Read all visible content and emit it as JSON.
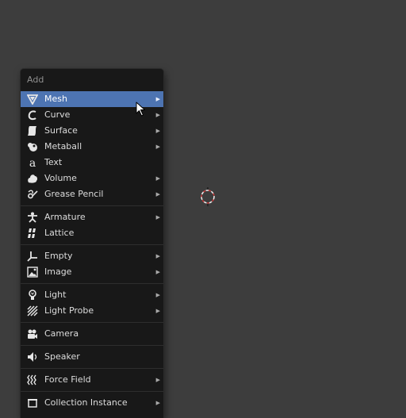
{
  "menu": {
    "title": "Add",
    "groups": [
      [
        {
          "label": "Mesh",
          "icon": "mesh-icon",
          "submenu": true,
          "active": true
        },
        {
          "label": "Curve",
          "icon": "curve-icon",
          "submenu": true
        },
        {
          "label": "Surface",
          "icon": "surface-icon",
          "submenu": true
        },
        {
          "label": "Metaball",
          "icon": "metaball-icon",
          "submenu": true
        },
        {
          "label": "Text",
          "icon": "text-icon",
          "submenu": false
        },
        {
          "label": "Volume",
          "icon": "volume-icon",
          "submenu": true
        },
        {
          "label": "Grease Pencil",
          "icon": "grease-pencil-icon",
          "submenu": true
        }
      ],
      [
        {
          "label": "Armature",
          "icon": "armature-icon",
          "submenu": true
        },
        {
          "label": "Lattice",
          "icon": "lattice-icon",
          "submenu": false
        }
      ],
      [
        {
          "label": "Empty",
          "icon": "empty-icon",
          "submenu": true
        },
        {
          "label": "Image",
          "icon": "image-icon",
          "submenu": true
        }
      ],
      [
        {
          "label": "Light",
          "icon": "light-icon",
          "submenu": true
        },
        {
          "label": "Light Probe",
          "icon": "light-probe-icon",
          "submenu": true
        }
      ],
      [
        {
          "label": "Camera",
          "icon": "camera-icon",
          "submenu": false
        }
      ],
      [
        {
          "label": "Speaker",
          "icon": "speaker-icon",
          "submenu": false
        }
      ],
      [
        {
          "label": "Force Field",
          "icon": "force-field-icon",
          "submenu": true
        }
      ],
      [
        {
          "label": "Collection Instance",
          "icon": "collection-instance-icon",
          "submenu": true
        }
      ]
    ],
    "submenu_glyph": "▶"
  },
  "colors": {
    "background": "#3d3d3d",
    "menu_bg": "#181818",
    "highlight": "#4d74b2"
  }
}
